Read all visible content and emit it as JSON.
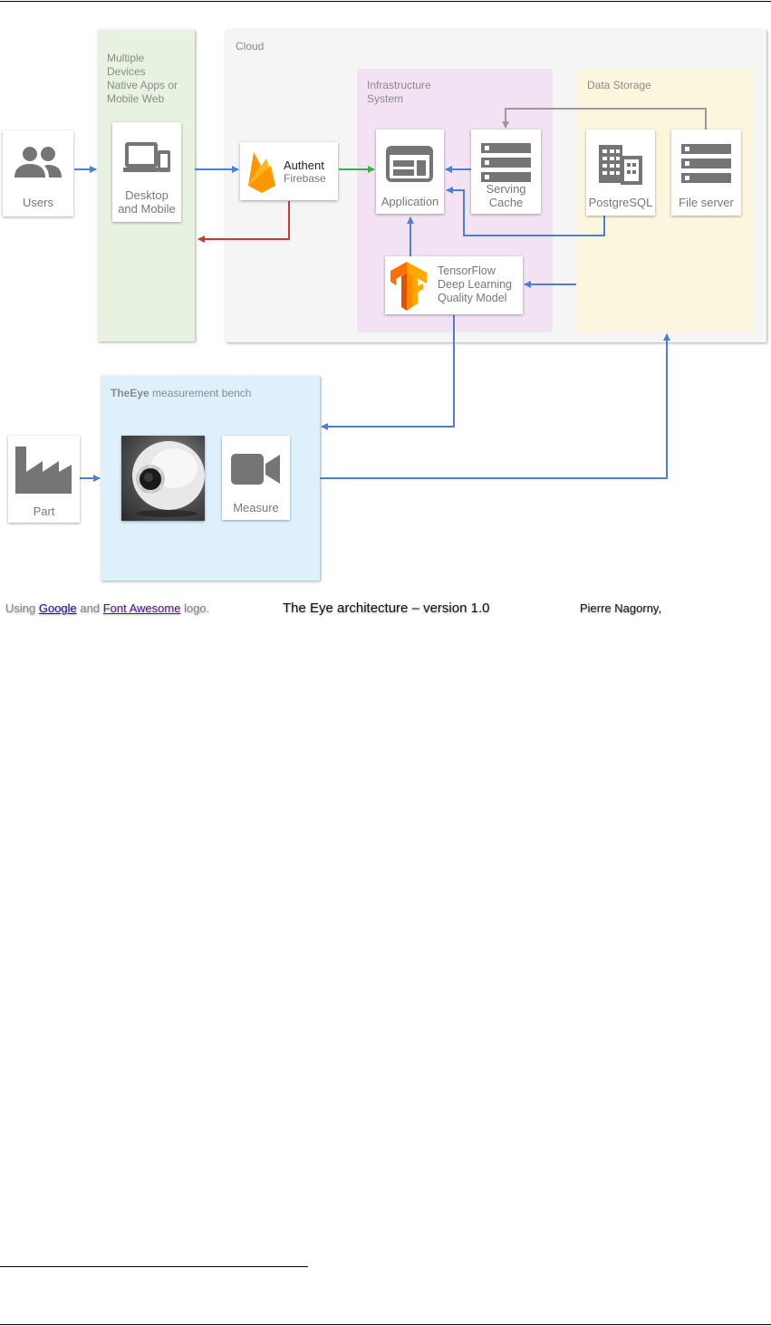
{
  "diagram": {
    "regions": {
      "devices": "Multiple\nDevices\nNative Apps or\nMobile Web",
      "cloud": "Cloud",
      "infrastructure": "Infrastructure\nSystem",
      "data_storage": "Data Storage",
      "bench_bold": "TheEye",
      "bench_rest": " measurement bench"
    },
    "nodes": {
      "users": "Users",
      "desktop": "Desktop\nand Mobile",
      "auth_title": "Authent",
      "auth_sub": "Firebase",
      "application": "Application",
      "serving_cache": "Serving\nCache",
      "postgresql": "PostgreSQL",
      "file_server": "File server",
      "tensorflow": "TensorFlow\nDeep Learning\nQuality Model",
      "part": "Part",
      "measure": "Measure"
    },
    "colors": {
      "arrow_blue": "#4a7fdc",
      "arrow_green": "#3daa4b",
      "arrow_red": "#d2362c",
      "arrow_gray": "#9a9a9a",
      "devices_bg": "#e8f2e0",
      "cloud_bg": "#f5f5f5",
      "infra_bg": "#f2e2f3",
      "storage_bg": "#fdf6df",
      "bench_bg": "#dff0fd"
    },
    "icons": [
      "users-icon",
      "devices-icon",
      "firebase-icon",
      "application-icon",
      "server-icon",
      "building-icon",
      "tensorflow-icon",
      "factory-icon",
      "camera-icon"
    ]
  },
  "footer": {
    "using": "Using ",
    "google": "Google",
    "and": " and ",
    "font_awesome": "Font Awesome",
    "logo": " logo.",
    "caption": "The Eye architecture – version 1.0",
    "author": "Pierre Nagorny,"
  }
}
